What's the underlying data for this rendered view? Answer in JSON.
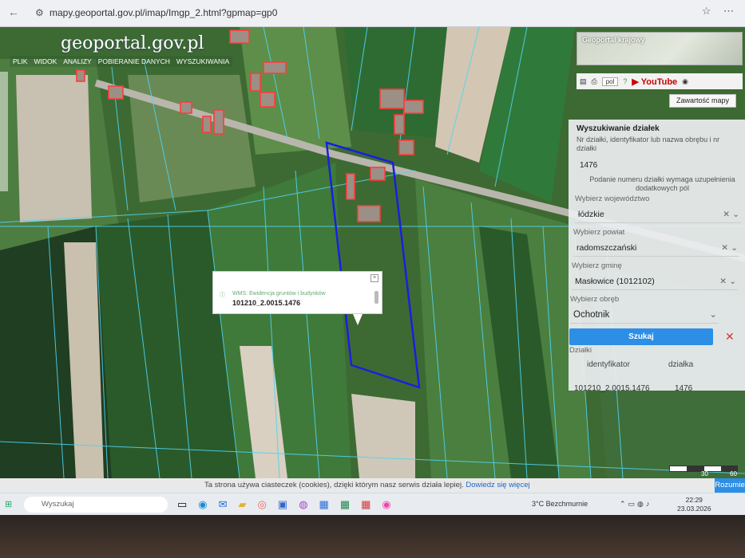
{
  "browser": {
    "url": "mapy.geoportal.gov.pl/imap/Imgp_2.html?gpmap=gp0"
  },
  "app": {
    "logo": "geoportal.gov.pl",
    "menu": [
      "PLIK",
      "WIDOK",
      "ANALIZY",
      "POBIERANIE DANYCH",
      "WYSZUKIWANIA"
    ],
    "minimap_title": "Geoportal krajowy",
    "format_select": "pol",
    "youtube_label": "YouTube",
    "layers_button": "Zawartość mapy"
  },
  "search_panel": {
    "title": "Wyszukiwanie działek",
    "subtitle": "Nr działki, identyfikator lub nazwa obrębu i nr działki",
    "parcel_value": "1476",
    "note": "Podanie numeru działki wymaga uzupełnienia dodatkowych pól",
    "voivodeship_label": "Wybierz województwo",
    "voivodeship_value": "łódzkie",
    "county_label": "Wybierz powiat",
    "county_value": "radomszczański",
    "commune_label": "Wybierz gminę",
    "commune_value": "Masłowice (1012102)",
    "precinct_label": "Wybierz obręb",
    "precinct_value": "Ochotnik",
    "search_button": "Szukaj",
    "results_label": "Działki",
    "col_identifier": "identyfikator",
    "col_parcel": "działka",
    "row_identifier": "101210_2.0015.1476",
    "row_parcel": "1476"
  },
  "popup": {
    "layer": "WMS: Ewidencja gruntów i budynków",
    "identifier": "101210_2.0015.1476"
  },
  "scale": {
    "label_a": "30",
    "label_b": "60"
  },
  "cookie_bar": {
    "message": "Ta strona używa ciasteczek (cookies), dzięki którym nasz serwis działa lepiej.",
    "link": "Dowiedz się więcej",
    "button": "Rozumie"
  },
  "taskbar": {
    "search_placeholder": "Wyszukaj",
    "weather": "3°C  Bezchmurnie",
    "time": "22:29",
    "date": "23.03.2026"
  }
}
